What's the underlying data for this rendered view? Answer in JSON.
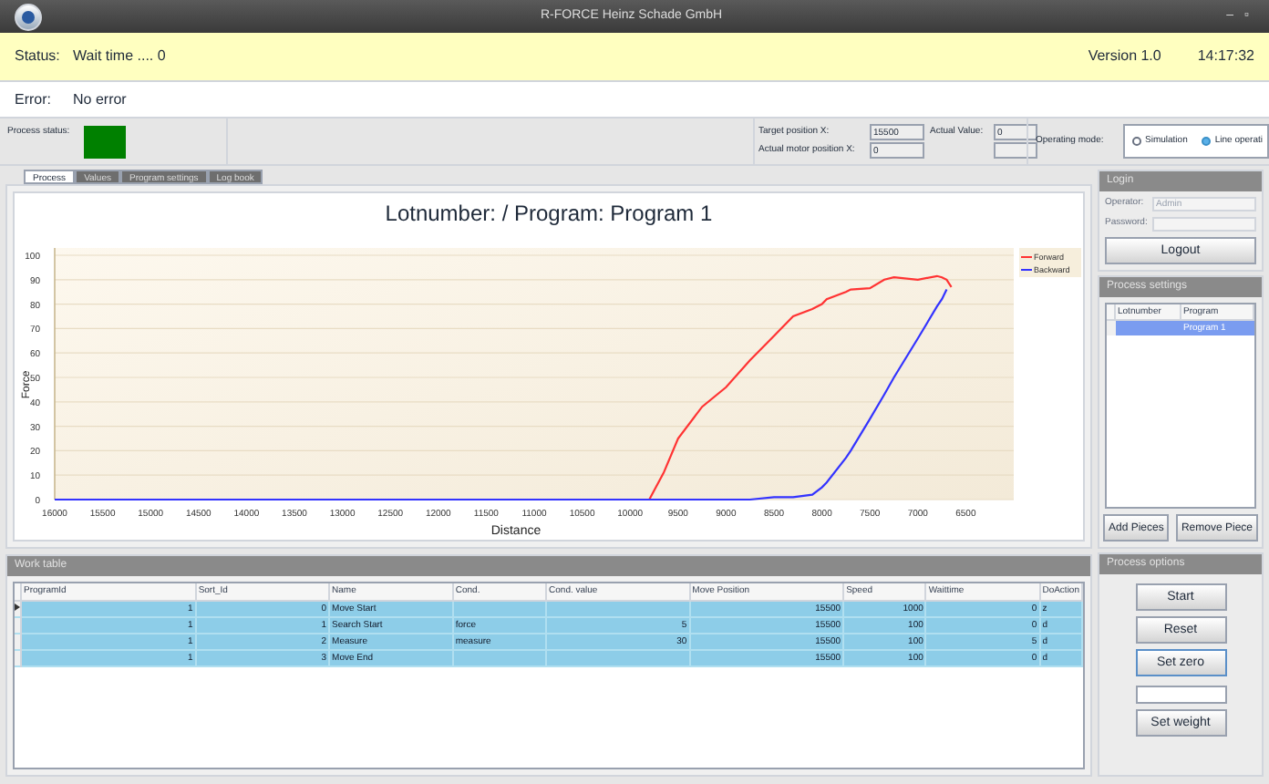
{
  "window": {
    "title": "R-FORCE Heinz Schade GmbH",
    "controls": [
      "–",
      "▫"
    ]
  },
  "status": {
    "label": "Status:",
    "value": "Wait time .... 0",
    "version": "Version 1.0",
    "time": "14:17:32"
  },
  "error": {
    "label": "Error:",
    "value": "No error"
  },
  "process_status": {
    "label": "Process status:",
    "color": "#008000"
  },
  "positions": {
    "target_label": "Target position X:",
    "target_value": "15500",
    "actual_label": "Actual Value:",
    "actual_value": "0",
    "motor_label": "Actual motor position X:",
    "motor_value": "0"
  },
  "operating_mode": {
    "label": "Operating mode:",
    "options": [
      {
        "label": "Simulation",
        "selected": false
      },
      {
        "label": "Line operati",
        "selected": true
      }
    ]
  },
  "tabs": [
    {
      "label": "Process",
      "selected": true
    },
    {
      "label": "Values",
      "selected": false
    },
    {
      "label": "Program settings",
      "selected": false
    },
    {
      "label": "Log book",
      "selected": false
    }
  ],
  "chart": {
    "chart_data": {
      "type": "line",
      "title": "Lotnumber:  / Program: Program 1",
      "xlabel": "Distance",
      "ylabel": "Force",
      "x": [
        16000,
        15500,
        15000,
        14500,
        14000,
        13500,
        13000,
        12500,
        12000,
        11500,
        11000,
        10500,
        10000,
        9800,
        9650,
        9500,
        9250,
        9000,
        8750,
        8500,
        8300,
        8100,
        8000,
        7950,
        7750,
        7700,
        7500,
        7350,
        7250,
        7000,
        6800,
        6750,
        6700,
        6650
      ],
      "series": [
        {
          "name": "Forward",
          "color": "#ff3333",
          "values": [
            null,
            null,
            null,
            null,
            null,
            null,
            null,
            null,
            null,
            null,
            null,
            null,
            null,
            0,
            11,
            25,
            38,
            46,
            57,
            67,
            75,
            78,
            80,
            82,
            85,
            86,
            86.5,
            90,
            91,
            90,
            91.5,
            91,
            90,
            87
          ]
        },
        {
          "name": "Backward",
          "color": "#3333ff",
          "values": [
            0,
            0,
            0,
            0,
            0,
            0,
            0,
            0,
            0,
            0,
            0,
            0,
            0,
            0,
            0,
            0,
            0,
            0,
            0,
            1,
            1,
            2,
            5,
            7,
            17,
            20,
            33,
            43,
            50,
            66,
            79,
            82,
            86,
            null
          ]
        }
      ],
      "xlim": [
        16000,
        6000
      ],
      "ylim": [
        0,
        100
      ],
      "grid": true,
      "legend": true,
      "xticks": [
        16000,
        15500,
        15000,
        14500,
        14000,
        13500,
        13000,
        12500,
        12000,
        11500,
        11000,
        10500,
        10000,
        9500,
        9000,
        8500,
        8000,
        7500,
        7000,
        6500
      ],
      "yticks": [
        0,
        10,
        20,
        30,
        40,
        50,
        60,
        70,
        80,
        90,
        100
      ]
    }
  },
  "work_table": {
    "title": "Work table",
    "columns": [
      "ProgramId",
      "Sort_Id",
      "Name",
      "Cond.",
      "Cond. value",
      "Move Position",
      "Speed",
      "Waittime",
      "DoAction"
    ],
    "rows": [
      {
        "current": true,
        "cells": [
          "1",
          "0",
          "Move Start",
          "",
          "",
          "15500",
          "1000",
          "0",
          "z"
        ]
      },
      {
        "current": false,
        "cells": [
          "1",
          "1",
          "Search Start",
          "force",
          "5",
          "15500",
          "100",
          "0",
          "d"
        ]
      },
      {
        "current": false,
        "cells": [
          "1",
          "2",
          "Measure",
          "measure",
          "30",
          "15500",
          "100",
          "5",
          "d"
        ]
      },
      {
        "current": false,
        "cells": [
          "1",
          "3",
          "Move End",
          "",
          "",
          "15500",
          "100",
          "0",
          "d"
        ]
      }
    ]
  },
  "login": {
    "title": "Login",
    "operator_label": "Operator:",
    "operator_value": "Admin",
    "password_label": "Password:",
    "button": "Logout"
  },
  "process_settings": {
    "title": "Process settings",
    "columns": [
      "Lotnumber",
      "Program"
    ],
    "rows": [
      {
        "selected": true,
        "cells": [
          "",
          "Program 1"
        ]
      }
    ],
    "buttons": [
      "Add Pieces",
      "Remove Piece"
    ]
  },
  "process_options": {
    "title": "Process options",
    "buttons": [
      {
        "label": "Start",
        "kind": "button"
      },
      {
        "label": "Reset",
        "kind": "button"
      },
      {
        "label": "Set zero",
        "kind": "focused"
      },
      {
        "kind": "field"
      },
      {
        "label": "Set weight",
        "kind": "button"
      }
    ]
  }
}
